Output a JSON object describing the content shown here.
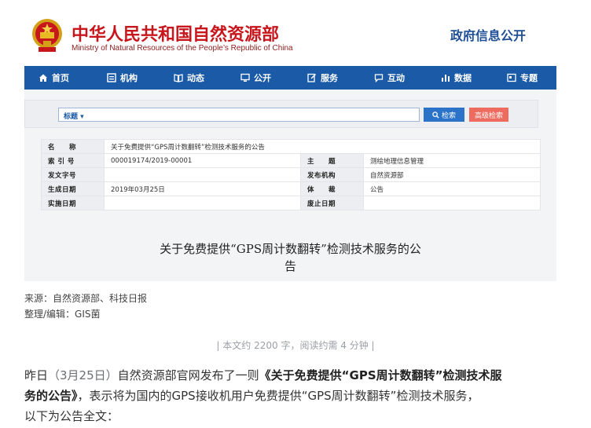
{
  "header": {
    "ministry_cn": "中华人民共和国自然资源部",
    "ministry_en": "Ministry of Natural Resources of the People’s Republic of China",
    "gov_info": "政府信息公开"
  },
  "nav": {
    "items": [
      {
        "label": "首页",
        "icon": "home-icon"
      },
      {
        "label": "机构",
        "icon": "org-icon"
      },
      {
        "label": "动态",
        "icon": "book-icon"
      },
      {
        "label": "公开",
        "icon": "monitor-icon"
      },
      {
        "label": "服务",
        "icon": "edit-icon"
      },
      {
        "label": "互动",
        "icon": "chat-icon"
      },
      {
        "label": "数据",
        "icon": "bar-chart-icon"
      },
      {
        "label": "专题",
        "icon": "folder-icon"
      }
    ]
  },
  "search": {
    "value": "标题",
    "search_label": "检索",
    "advanced_label": "高级检索"
  },
  "meta": {
    "name_label": "名　　称",
    "name_value": "关于免费提供“GPS周计数翻转”检测技术服务的公告",
    "index_label": "索 引 号",
    "index_value": "000019174/2019-00001",
    "subject_label": "主　　题",
    "subject_value": "测绘地理信息管理",
    "docno_label": "发文字号",
    "docno_value": "",
    "issuer_label": "发布机构",
    "issuer_value": "自然资源部",
    "date_label": "生成日期",
    "date_value": "2019年03月25日",
    "genre_label": "体　　裁",
    "genre_value": "公告",
    "effective_label": "实施日期",
    "effective_value": "",
    "expire_label": "废止日期",
    "expire_value": ""
  },
  "doc": {
    "title_line1": "关于免费提供“GPS周计数翻转”检测技术服务的公",
    "title_line2": "告"
  },
  "article": {
    "source": "来源：自然资源部、科技日报",
    "editor": "整理/编辑：GIS菌",
    "read_info": "| 本文约 2200 字，阅读约需 4 分钟 |",
    "p1_a": "昨日",
    "p1_date": "（3月25日）",
    "p1_b": "自然资源部官网发布了一则",
    "p1_bold1": "《关于免费提供“GPS周计数翻转”检测技术服",
    "p2_bold2": "务的公告》",
    "p2_rest": "，表示将为国内的GPS接收机用户免费提供“GPS周计数翻转”检测技术服务，",
    "p3": "以下为公告全文："
  },
  "colors": {
    "brand_red": "#c8161d",
    "nav_blue": "#1b5aa6",
    "search_blue": "#2a73c9",
    "advanced_red": "#ee6c5f"
  }
}
